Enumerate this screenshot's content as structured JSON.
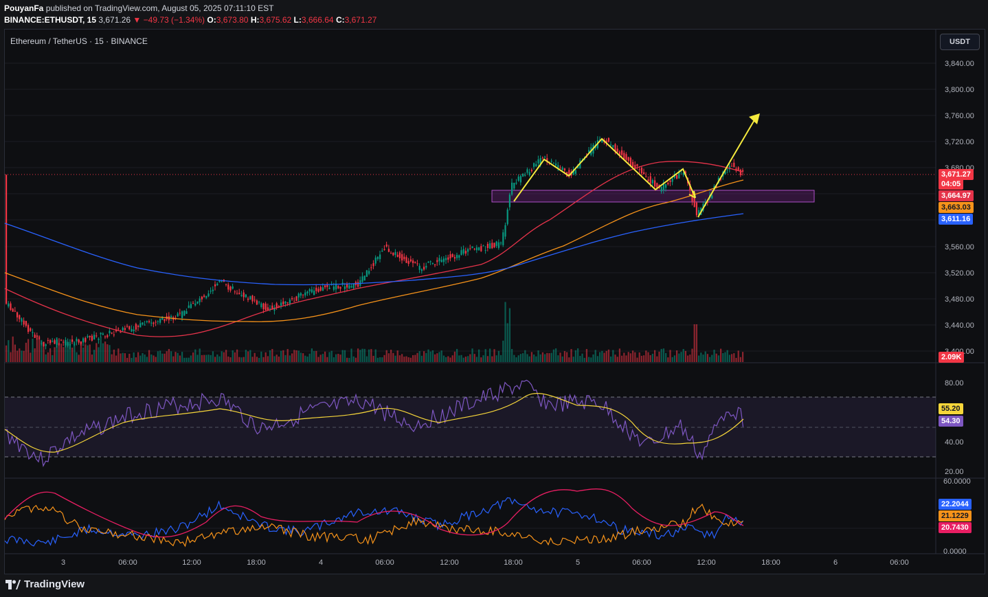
{
  "header": {
    "author": "PouyanFa",
    "published_text": "published on TradingView.com, August 05, 2025 07:11:10 EST",
    "symbol": "BINANCE:ETHUSDT, 15",
    "last": "3,671.26",
    "change": "−49.73 (−1.34%)",
    "open_label": "O:",
    "open": "3,673.80",
    "high_label": "H:",
    "high": "3,675.62",
    "low_label": "L:",
    "low": "3,666.64",
    "close_label": "C:",
    "close": "3,671.27"
  },
  "legend": {
    "title": "Ethereum / TetherUS · 15 · BINANCE"
  },
  "currency_button": "USDT",
  "price_axis": [
    "3,840.00",
    "3,800.00",
    "3,760.00",
    "3,720.00",
    "3,680.00",
    "3,560.00",
    "3,520.00",
    "3,480.00",
    "3,440.00",
    "3,400.00"
  ],
  "price_tags": {
    "last_price": "3,671.27",
    "countdown": "04:05",
    "ma1": "3,664.97",
    "ma2": "3,663.03",
    "ma3": "3,611.16",
    "volume": "2.09K"
  },
  "rsi_axis": [
    "80.00",
    "40.00",
    "20.00"
  ],
  "rsi_tags": {
    "ma": "55.20",
    "rsi": "54.30"
  },
  "dmi_axis": [
    "60.0000",
    "0.0000"
  ],
  "dmi_tags": {
    "blue": "22.2044",
    "orange": "21.1229",
    "red": "20.7430"
  },
  "time_axis": [
    "3",
    "06:00",
    "12:00",
    "18:00",
    "4",
    "06:00",
    "12:00",
    "18:00",
    "5",
    "06:00",
    "12:00",
    "18:00",
    "6",
    "06:00"
  ],
  "footer": {
    "brand": "TradingView"
  },
  "colors": {
    "up": "#089981",
    "down": "#f23645",
    "ma_red": "#e5334a",
    "ma_orange": "#f7931a",
    "ma_blue": "#2962ff",
    "rsi": "#7e57c2",
    "rsi_ma": "#f6d63a",
    "annot": "#f5ea3e",
    "zone": "#9c27b0"
  }
}
